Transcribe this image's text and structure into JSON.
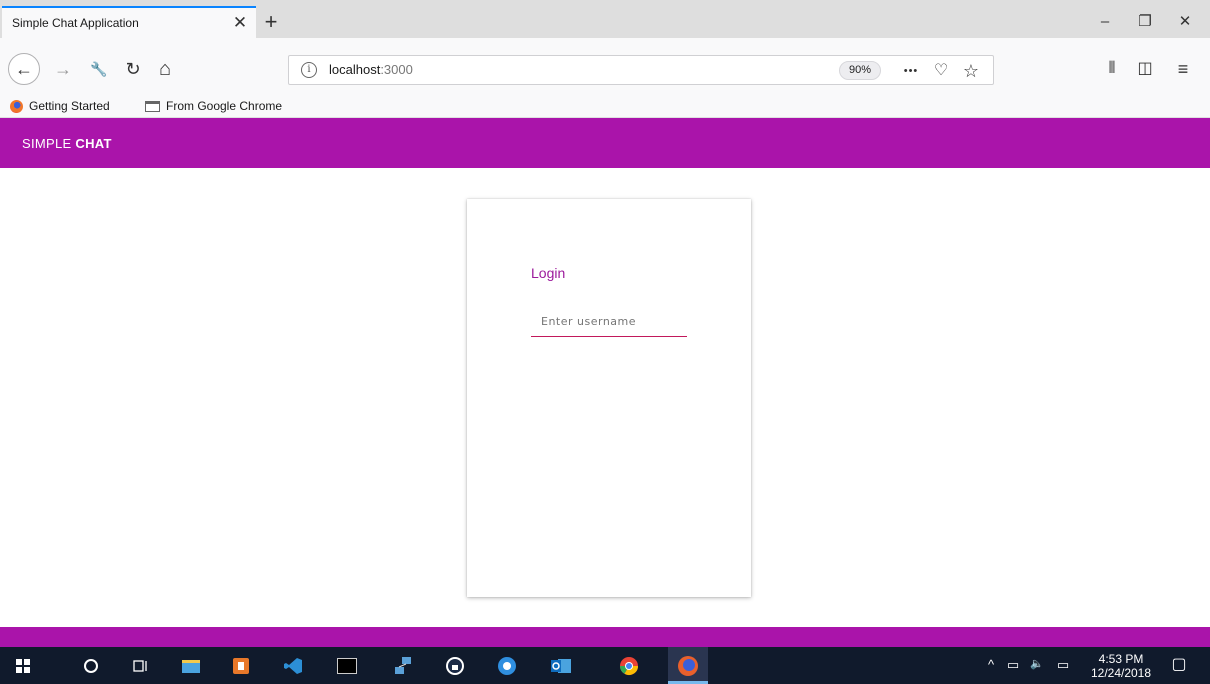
{
  "browser": {
    "tab": {
      "title": "Simple Chat Application",
      "close_glyph": "✕"
    },
    "new_tab_glyph": "+",
    "window_controls": {
      "minimize": "–",
      "restore": "❐",
      "close": "✕"
    },
    "nav": {
      "back": "←",
      "forward": "→",
      "tools": "🔧",
      "reload": "↻",
      "home": "⌂"
    },
    "url": {
      "host": "localhost",
      "port": ":3000",
      "info_glyph": "i"
    },
    "zoom": "90%",
    "url_actions": {
      "more": "•••",
      "pocket": "♡",
      "bookmark_star": "☆"
    },
    "toolbar": {
      "library": "⫴",
      "sidebar": "◫",
      "menu": "≡"
    },
    "bookmarks": [
      {
        "label": "Getting Started",
        "icon": "firefox-icon"
      },
      {
        "label": "From Google Chrome",
        "icon": "folder-icon"
      }
    ]
  },
  "app": {
    "brand_light": "SIMPLE",
    "brand_bold": "CHAT",
    "header_color": "#aa14aa",
    "login": {
      "title": "Login",
      "username_placeholder": "Enter username",
      "username_value": ""
    }
  },
  "taskbar": {
    "apps": [
      "windows-start-icon",
      "cortana-icon",
      "task-view-icon",
      "file-explorer-icon",
      "office-icon",
      "vscode-icon",
      "terminal-icon",
      "network-icon",
      "password-manager-icon",
      "sync-icon",
      "outlook-icon",
      "chrome-icon",
      "firefox-icon"
    ],
    "tray": {
      "chevron": "^",
      "battery": "▭",
      "volume": "🔈",
      "network": "▭"
    },
    "time": "4:53 PM",
    "date": "12/24/2018",
    "notification": "▢"
  }
}
